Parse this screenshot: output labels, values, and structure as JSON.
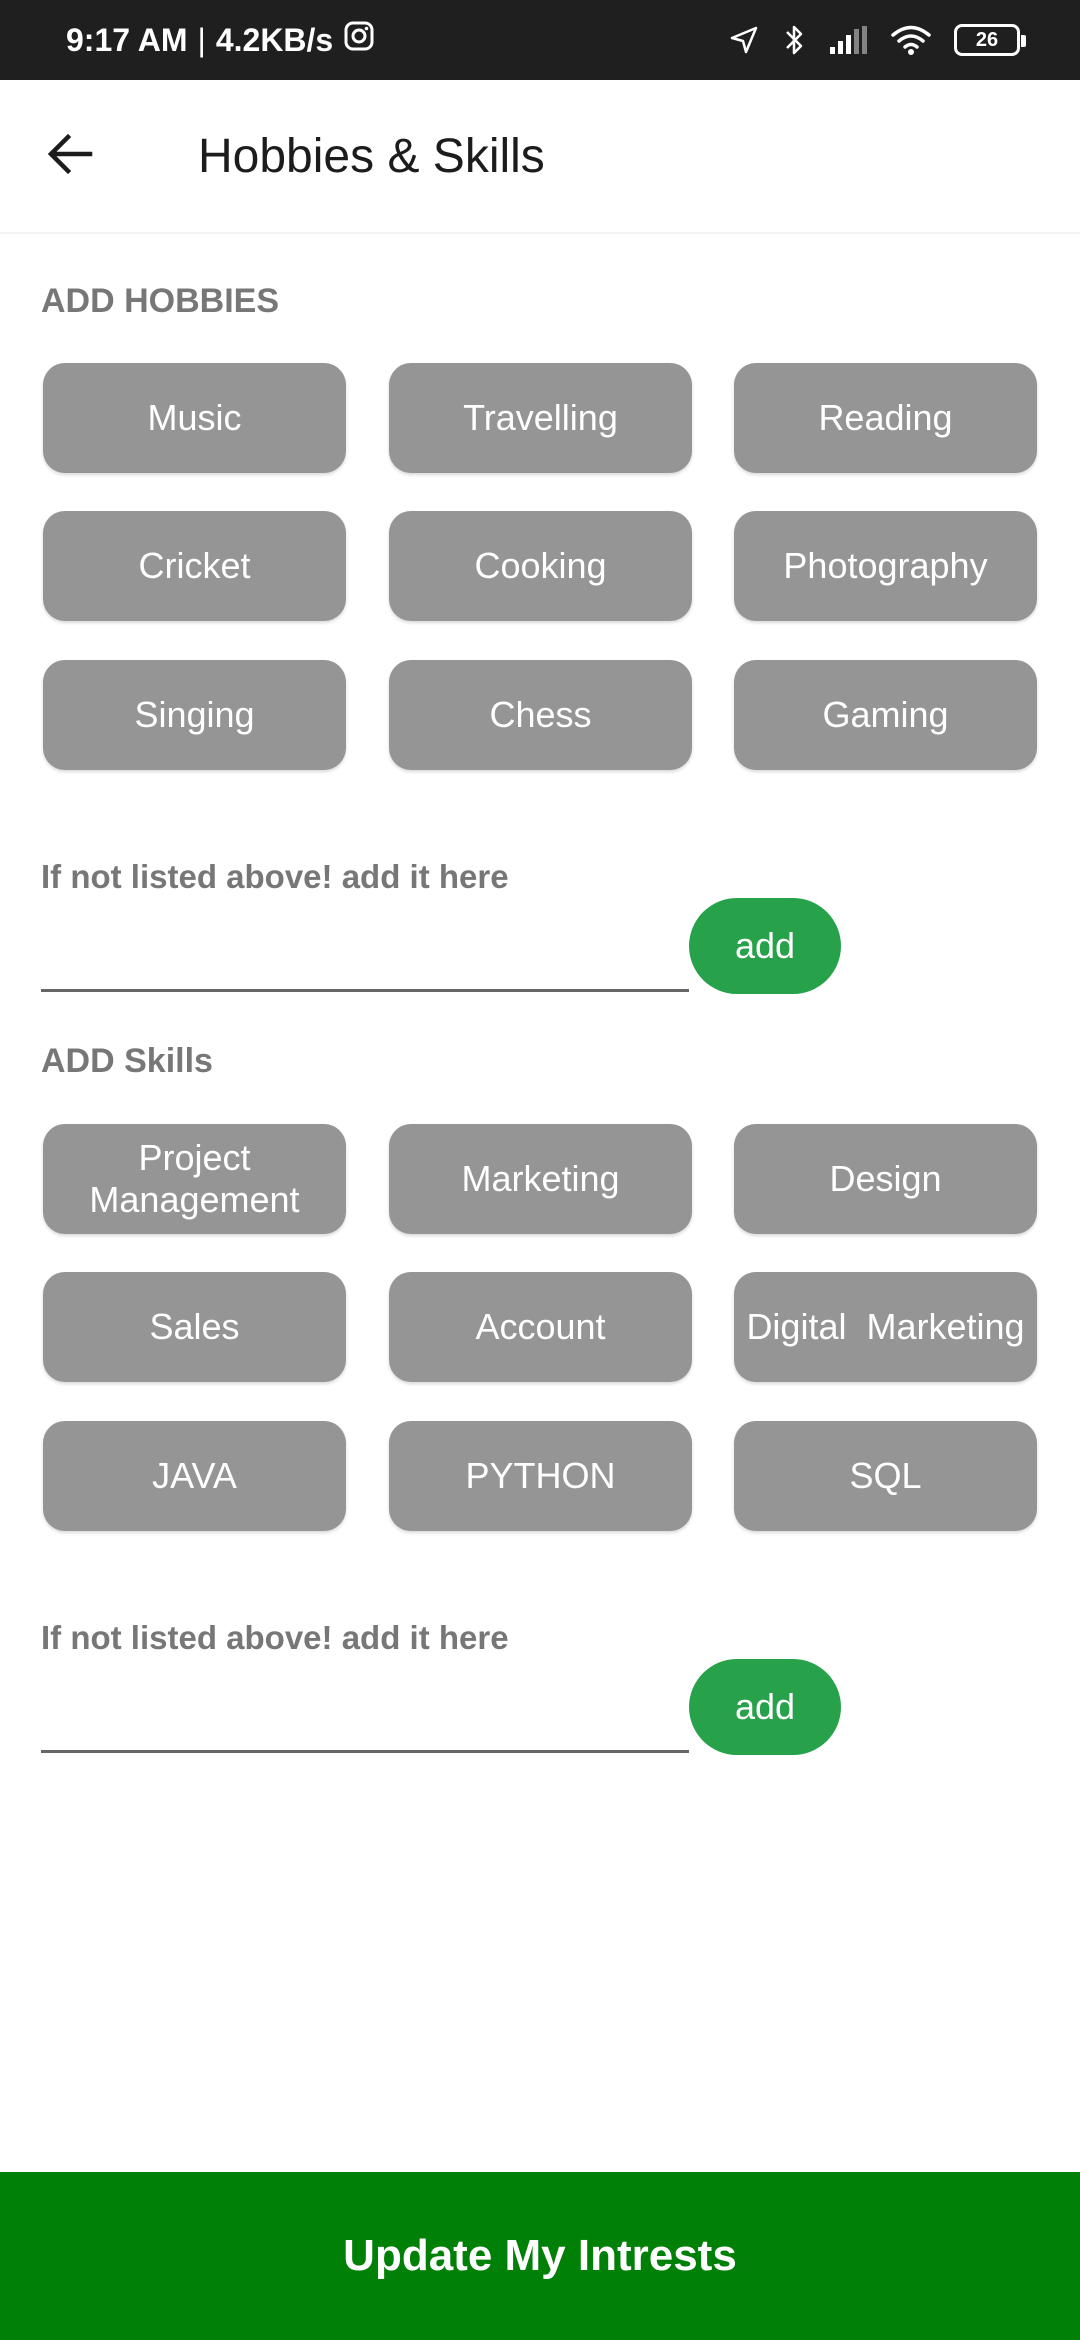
{
  "status_bar": {
    "time": "9:17 AM",
    "separator": "|",
    "speed": "4.2KB/s",
    "battery": "26"
  },
  "header": {
    "title": "Hobbies & Skills",
    "back_icon": "arrow-back-icon"
  },
  "hobbies": {
    "section_title": "ADD HOBBIES",
    "chips": [
      "Music",
      "Travelling",
      "Reading",
      "Cricket",
      "Cooking",
      "Photography",
      "Singing",
      "Chess",
      "Gaming"
    ],
    "helper_label": "If not listed above! add it here",
    "input_value": "",
    "add_label": "add"
  },
  "skills": {
    "section_title": "ADD Skills",
    "chips": [
      "Project\nManagement",
      "Marketing",
      "Design",
      "Sales",
      "Account",
      "Digital  Marketing",
      "JAVA",
      "PYTHON",
      "SQL"
    ],
    "helper_label": "If not listed above! add it here",
    "input_value": "",
    "add_label": "add"
  },
  "footer": {
    "update_label": "Update My Intrests"
  },
  "colors": {
    "chip_bg": "#959595",
    "add_button": "#27a24b",
    "update_button": "#008006",
    "status_bar": "#1f1f1f"
  }
}
